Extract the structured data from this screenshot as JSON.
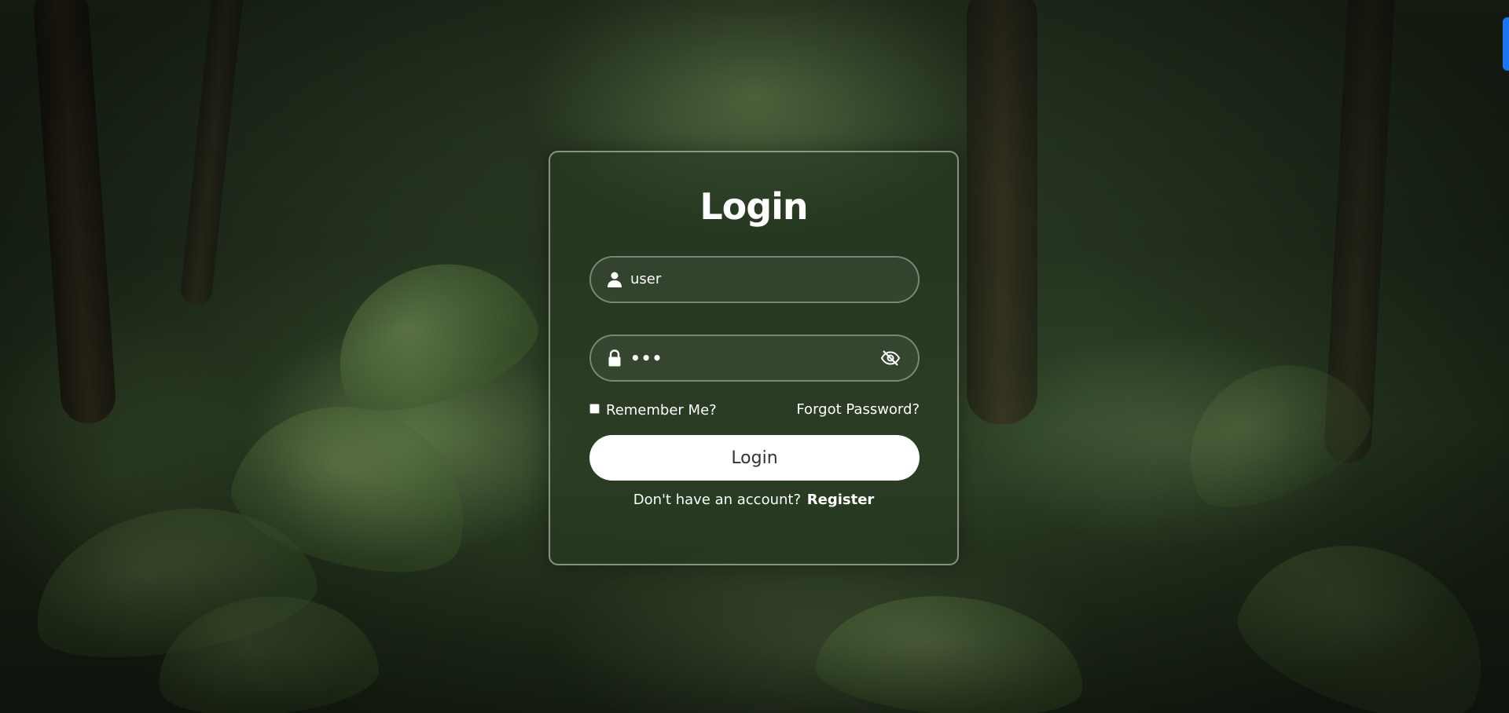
{
  "page": {
    "background": "jungle-forest-photo"
  },
  "login_card": {
    "title": "Login",
    "username": {
      "value": "user",
      "icon": "user-icon"
    },
    "password": {
      "value": "•••",
      "icon": "lock-icon",
      "toggle_icon": "eye-off-icon"
    },
    "remember_label": "Remember Me?",
    "remember_checked": false,
    "forgot_label": "Forgot Password?",
    "submit_label": "Login",
    "register_prompt": "Don't have an account?",
    "register_label": "Register"
  },
  "colors": {
    "accent": "#1976f2",
    "button_bg": "#ffffff",
    "text": "#ffffff"
  }
}
